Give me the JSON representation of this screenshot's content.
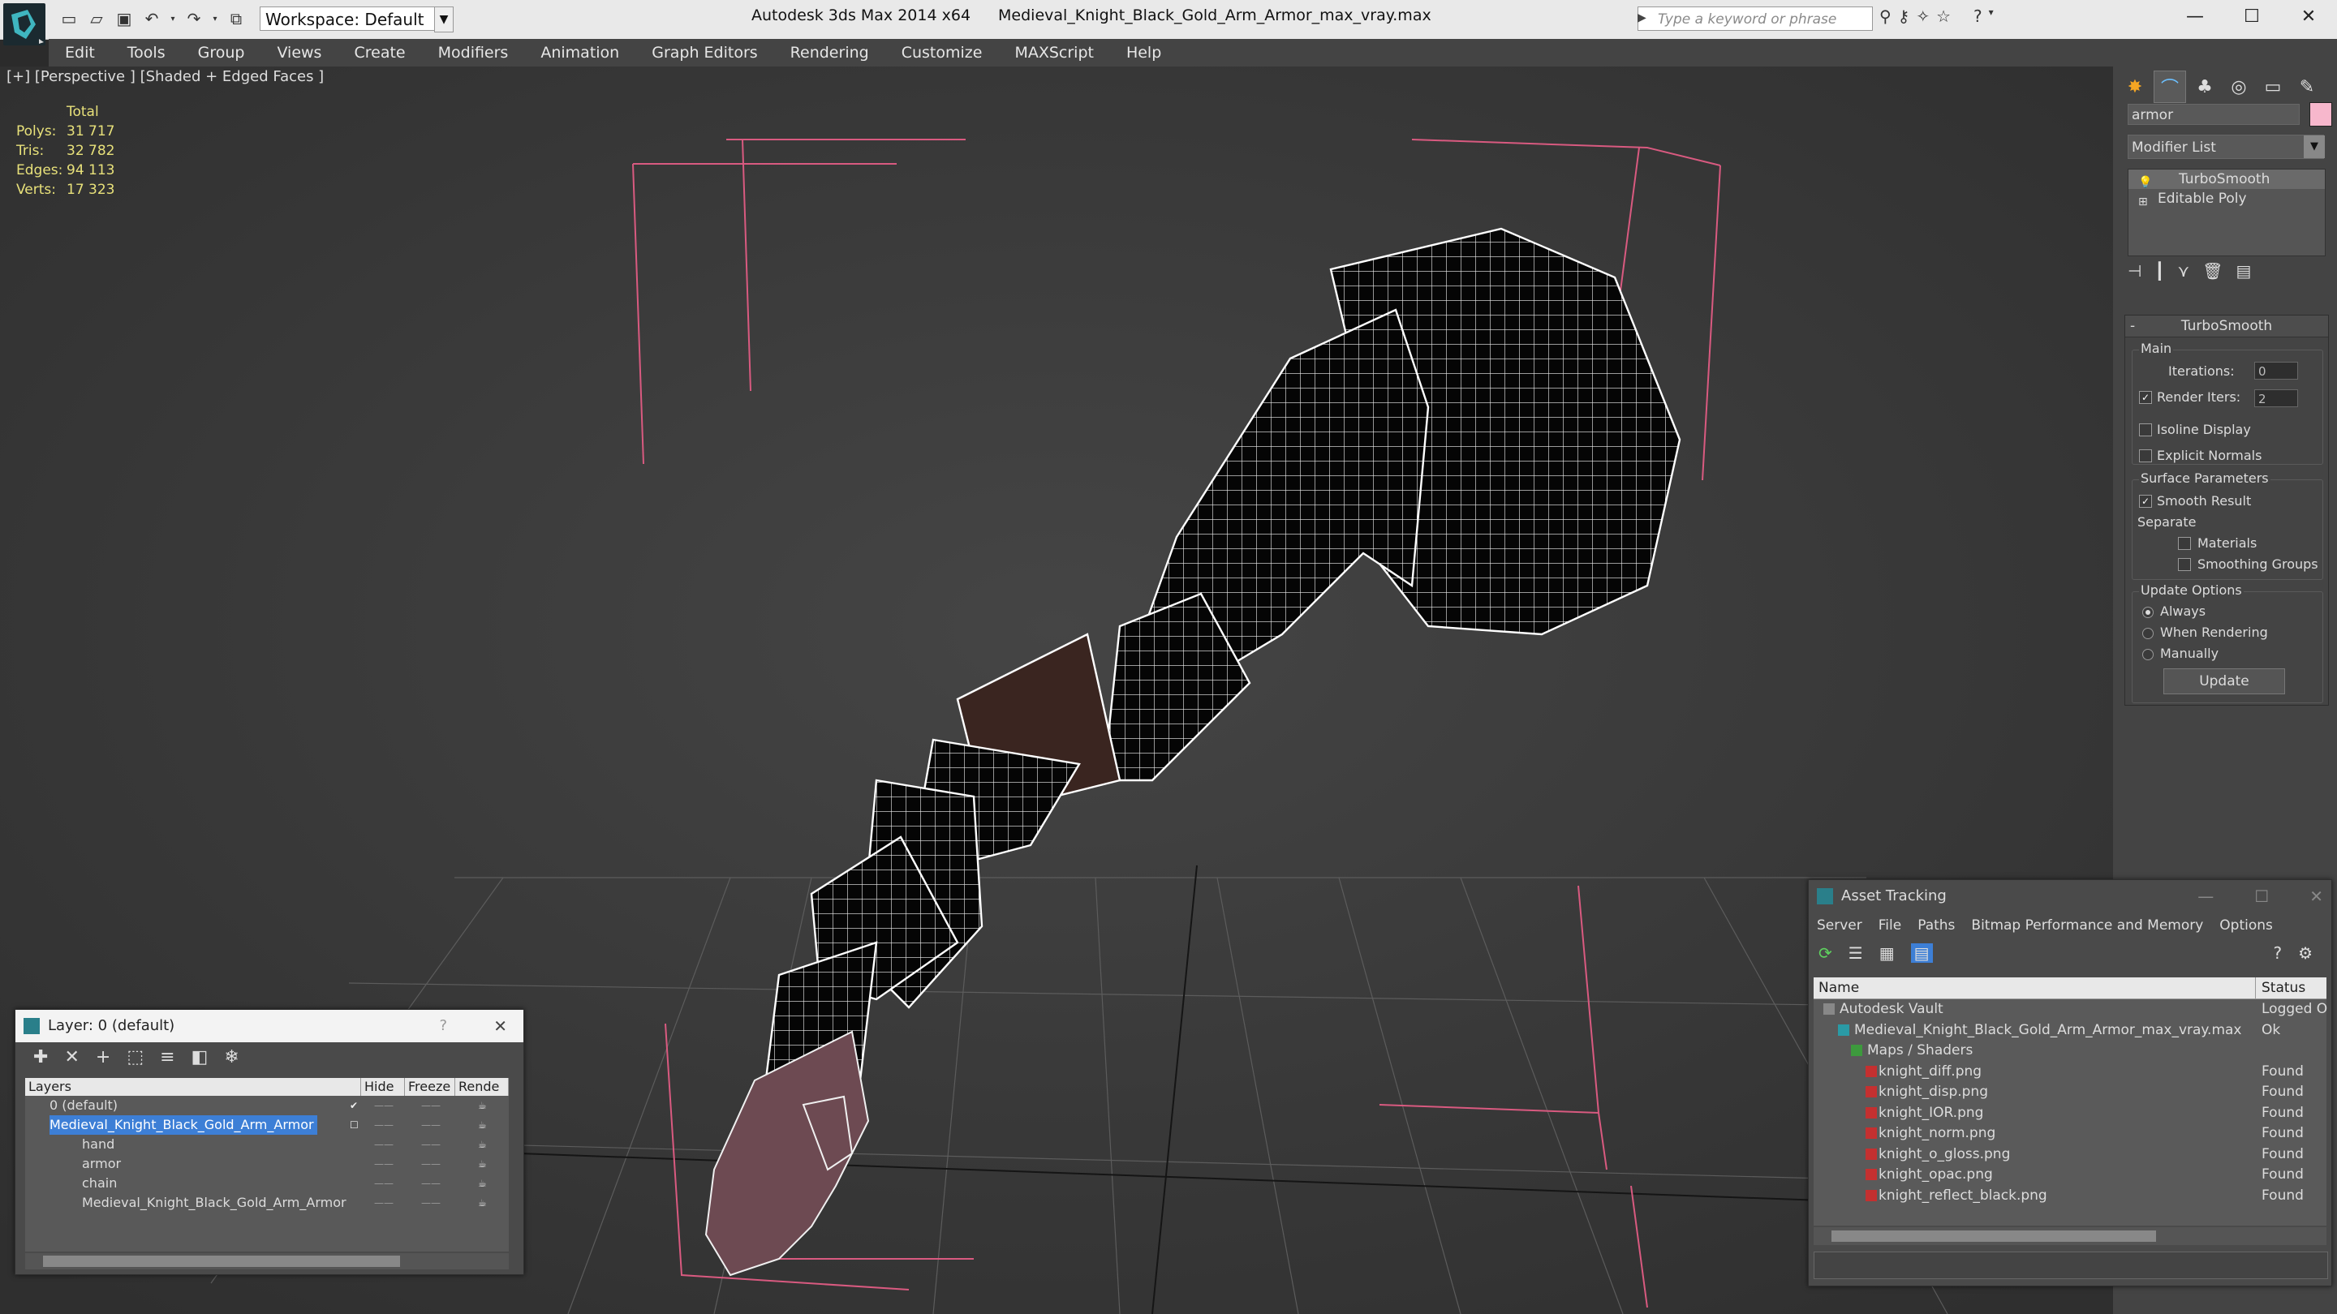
{
  "app": {
    "title": "Autodesk 3ds Max  2014 x64",
    "file": "Medieval_Knight_Black_Gold_Arm_Armor_max_vray.max",
    "workspace": "Workspace: Default",
    "search_placeholder": "Type a keyword or phrase"
  },
  "menu": [
    "Edit",
    "Tools",
    "Group",
    "Views",
    "Create",
    "Modifiers",
    "Animation",
    "Graph Editors",
    "Rendering",
    "Customize",
    "MAXScript",
    "Help"
  ],
  "viewport": {
    "label": "[+] [Perspective ] [Shaded + Edged Faces ]",
    "stats": {
      "header": "Total",
      "rows": [
        {
          "k": "Polys:",
          "v": "31 717"
        },
        {
          "k": "Tris:",
          "v": "32 782"
        },
        {
          "k": "Edges:",
          "v": "94 113"
        },
        {
          "k": "Verts:",
          "v": "17 323"
        }
      ]
    }
  },
  "command_panel": {
    "object_name": "armor",
    "object_color": "#f7b7cc",
    "modifier_list": "Modifier List",
    "stack": [
      "TurboSmooth",
      "Editable Poly"
    ],
    "rollout": {
      "title": "TurboSmooth",
      "main": "Main",
      "iterations_label": "Iterations:",
      "iterations_value": "0",
      "render_iters_label": "Render Iters:",
      "render_iters_value": "2",
      "isoline": "Isoline Display",
      "explicit_normals": "Explicit Normals",
      "surface_params": "Surface Parameters",
      "smooth_result": "Smooth Result",
      "separate": "Separate",
      "materials": "Materials",
      "smoothing_groups": "Smoothing Groups",
      "update_options": "Update Options",
      "always": "Always",
      "when_rendering": "When Rendering",
      "manually": "Manually",
      "update": "Update"
    }
  },
  "layer_window": {
    "title": "Layer: 0 (default)",
    "help": "?",
    "columns": [
      "Layers",
      "Hide",
      "Freeze",
      "Rende"
    ],
    "rows": [
      {
        "name": "0 (default)"
      },
      {
        "name": "Medieval_Knight_Black_Gold_Arm_Armor"
      },
      {
        "name": "hand"
      },
      {
        "name": "armor"
      },
      {
        "name": "chain"
      },
      {
        "name": "Medieval_Knight_Black_Gold_Arm_Armor"
      }
    ]
  },
  "asset_tracking": {
    "title": "Asset Tracking",
    "menu": [
      "Server",
      "File",
      "Paths",
      "Bitmap Performance and Memory",
      "Options"
    ],
    "columns": [
      "Name",
      "Status"
    ],
    "rows": [
      {
        "name": "Autodesk Vault",
        "status": "Logged O"
      },
      {
        "name": "Medieval_Knight_Black_Gold_Arm_Armor_max_vray.max",
        "status": "Ok"
      },
      {
        "name": "Maps / Shaders",
        "status": ""
      },
      {
        "name": "knight_diff.png",
        "status": "Found"
      },
      {
        "name": "knight_disp.png",
        "status": "Found"
      },
      {
        "name": "knight_IOR.png",
        "status": "Found"
      },
      {
        "name": "knight_norm.png",
        "status": "Found"
      },
      {
        "name": "knight_o_gloss.png",
        "status": "Found"
      },
      {
        "name": "knight_opac.png",
        "status": "Found"
      },
      {
        "name": "knight_reflect_black.png",
        "status": "Found"
      }
    ]
  }
}
